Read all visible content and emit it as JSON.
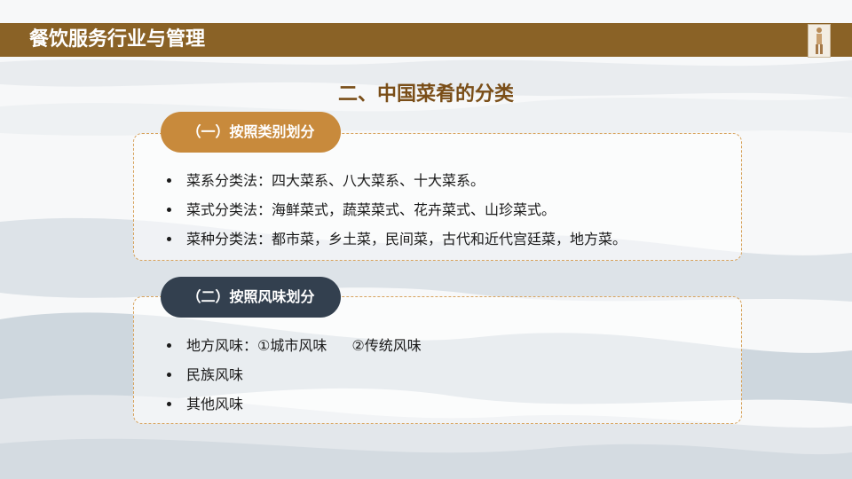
{
  "header": {
    "title": "餐饮服务行业与管理"
  },
  "slide_title": "二、中国菜肴的分类",
  "sections": [
    {
      "heading": "（一）按照类别划分",
      "items": [
        "菜系分类法：四大菜系、八大菜系、十大菜系。",
        "菜式分类法：海鲜菜式，蔬菜菜式、花卉菜式、山珍菜式。",
        "菜种分类法：都市菜，乡土菜，民间菜，古代和近代宫廷菜，地方菜。"
      ]
    },
    {
      "heading": "（二）按照风味划分",
      "items": [
        {
          "part1": "地方风味：①城市风味",
          "part2": "②传统风味"
        },
        "民族风味",
        "其他风味"
      ]
    }
  ],
  "colors": {
    "header_bar": "#8a6226",
    "title_text": "#7a4e18",
    "pill_1": "#c88a3c",
    "pill_2": "#33404f",
    "box_border": "#d7a35d"
  }
}
